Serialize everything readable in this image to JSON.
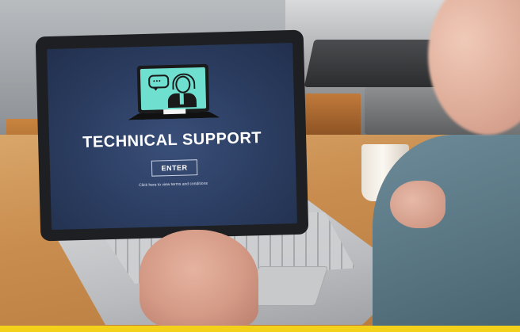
{
  "screen": {
    "headline": "TECHNICAL SUPPORT",
    "enter_label": "ENTER",
    "terms_text": "Click here to view terms and conditions"
  },
  "icons": {
    "support_monitor": "support-agent-monitor-icon",
    "speech": "speech-bubble-icon",
    "agent": "headset-agent-icon"
  },
  "colors": {
    "screen_background": "#2b3d61",
    "icon_accent": "#6fe0cf",
    "headline_text": "#ffffff",
    "bottom_strip": "#f3d01a"
  }
}
